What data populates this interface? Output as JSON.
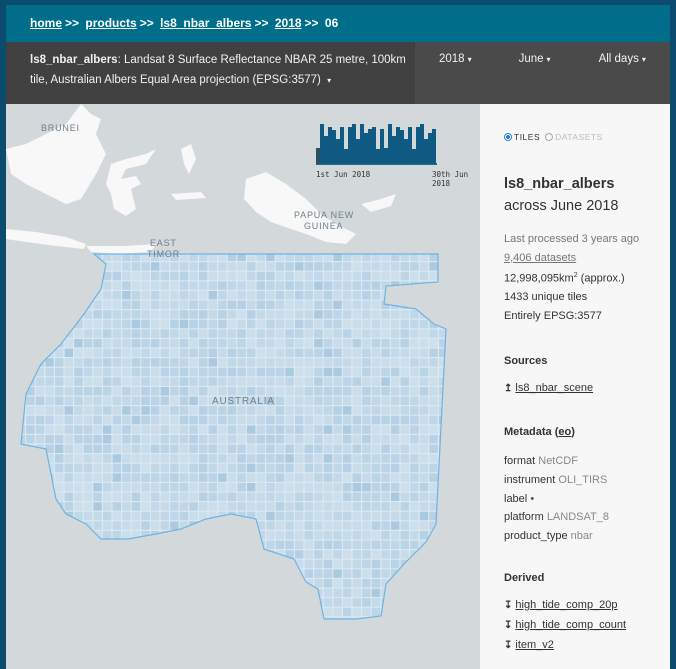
{
  "breadcrumb": {
    "items": [
      "home",
      "products",
      "ls8_nbar_albers",
      "2018"
    ],
    "separator": ">>",
    "current": "06"
  },
  "header": {
    "product_name": "ls8_nbar_albers",
    "description": ": Landsat 8 Surface Reflectance NBAR 25 metre, 100km tile, Australian Albers Equal Area projection (EPSG:3577)",
    "year_select": "2018",
    "month_select": "June",
    "day_select": "All days",
    "dropdown_glyph": "▾"
  },
  "map": {
    "labels": {
      "brunei": "BRUNEI",
      "papua_1": "PAPUA NEW",
      "papua_2": "GUINEA",
      "east_timor_1": "EAST",
      "east_timor_2": "TIMOR",
      "australia": "AUSTRALIA"
    },
    "histogram": {
      "start_label": "1st Jun 2018",
      "end_label": "30th Jun 2018",
      "relative_counts": [
        0.41,
        1.0,
        0.69,
        0.92,
        0.85,
        0.62,
        0.92,
        0.38,
        0.92,
        1.0,
        0.62,
        1.0,
        0.77,
        0.87,
        0.92,
        0.38,
        0.87,
        0.41,
        1.0,
        0.69,
        0.92,
        0.85,
        0.62,
        0.92,
        0.38,
        0.92,
        1.0,
        0.62,
        0.77,
        0.87
      ],
      "bar_color": "#0f5a82"
    },
    "tile_color": "#a9c9e0",
    "footprint_outline_color": "#6eb4e0"
  },
  "sidebar": {
    "toggle": {
      "tiles": "TILES",
      "datasets": "DATASETS",
      "selected": "tiles"
    },
    "product_name": "ls8_nbar_albers",
    "period": "across June 2018",
    "last_processed": "Last processed 3 years ago",
    "dataset_count": "9,406 datasets",
    "area": "12,998,095km",
    "area_sup": "2",
    "area_suffix": " (approx.)",
    "unique_tiles": "1433 unique tiles",
    "crs": "Entirely EPSG:3577",
    "sources_heading": "Sources",
    "sources": [
      {
        "icon": "↥",
        "label": "ls8_nbar_scene"
      }
    ],
    "metadata_heading": "Metadata (",
    "metadata_link": "eo",
    "metadata_close": ")",
    "metadata": [
      {
        "key": "format",
        "value": "NetCDF"
      },
      {
        "key": "instrument",
        "value": "OLI_TIRS"
      },
      {
        "key": "label",
        "value": "•"
      },
      {
        "key": "platform",
        "value": "LANDSAT_8"
      },
      {
        "key": "product_type",
        "value": "nbar"
      }
    ],
    "derived_heading": "Derived",
    "derived": [
      {
        "icon": "↧",
        "label": "high_tide_comp_20p"
      },
      {
        "icon": "↧",
        "label": "high_tide_comp_count"
      },
      {
        "icon": "↧",
        "label": "item_v2"
      }
    ]
  }
}
